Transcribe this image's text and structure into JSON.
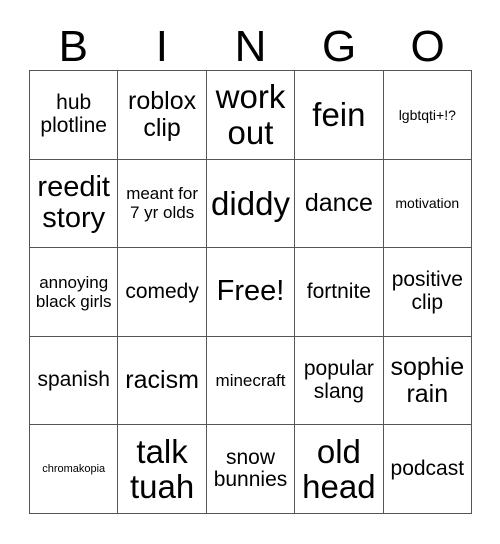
{
  "card": {
    "title": "BINGO",
    "header": {
      "letters": [
        "B",
        "I",
        "N",
        "G",
        "O"
      ]
    },
    "free_space": {
      "index": 12,
      "label": "Free!"
    },
    "grid": {
      "columns": 5,
      "rows": 5,
      "border_color": "#555555",
      "background_color": "#ffffff",
      "text_color": "#000000"
    },
    "rows": [
      [
        {
          "label": "hub plotline",
          "size": "md"
        },
        {
          "label": "roblox clip",
          "size": "lg"
        },
        {
          "label": "work out",
          "size": "xxl"
        },
        {
          "label": "fein",
          "size": "xxl"
        },
        {
          "label": "lgbtqti+!?",
          "size": "xs"
        }
      ],
      [
        {
          "label": "reedit story",
          "size": "xl"
        },
        {
          "label": "meant for 7 yr olds",
          "size": "sm"
        },
        {
          "label": "diddy",
          "size": "xxl"
        },
        {
          "label": "dance",
          "size": "lg"
        },
        {
          "label": "motivation",
          "size": "xs"
        }
      ],
      [
        {
          "label": "annoying black girls",
          "size": "sm"
        },
        {
          "label": "comedy",
          "size": "md"
        },
        {
          "label": "Free!",
          "size": "xl"
        },
        {
          "label": "fortnite",
          "size": "md"
        },
        {
          "label": "positive clip",
          "size": "md"
        }
      ],
      [
        {
          "label": "spanish",
          "size": "md"
        },
        {
          "label": "racism",
          "size": "lg"
        },
        {
          "label": "minecraft",
          "size": "sm"
        },
        {
          "label": "popular slang",
          "size": "md"
        },
        {
          "label": "sophie rain",
          "size": "lg"
        }
      ],
      [
        {
          "label": "chromakopia",
          "size": "xxs"
        },
        {
          "label": "talk tuah",
          "size": "xxl"
        },
        {
          "label": "snow bunnies",
          "size": "md"
        },
        {
          "label": "old head",
          "size": "xxl"
        },
        {
          "label": "podcast",
          "size": "md"
        }
      ]
    ]
  }
}
